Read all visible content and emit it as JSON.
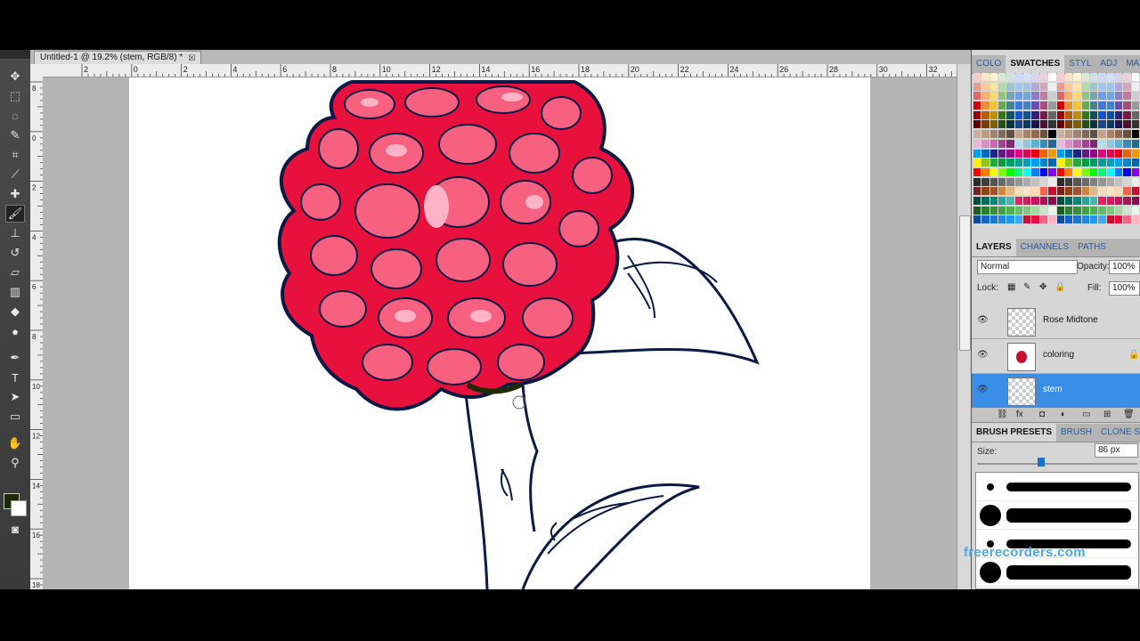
{
  "document": {
    "tab_title": "Untitled-1 @ 19.2% (stem, RGB/8) *",
    "close_glyph": "☒"
  },
  "ruler": {
    "top_labels": [
      "2",
      "0",
      "2",
      "4",
      "6",
      "8",
      "10",
      "12",
      "14",
      "16",
      "18",
      "20",
      "22",
      "24",
      "26",
      "28",
      "30",
      "32"
    ],
    "left_labels": [
      "8",
      "0",
      "2",
      "4",
      "6",
      "8",
      "10",
      "12",
      "14",
      "16",
      "18"
    ]
  },
  "panels": {
    "swatch_tabs": [
      "COLO",
      "SWATCHES",
      "STYL",
      "ADJ",
      "MAS"
    ],
    "layer_tabs": [
      "LAYERS",
      "CHANNELS",
      "PATHS"
    ],
    "blend_mode": "Normal",
    "opacity_label": "Opacity:",
    "opacity_value": "100%",
    "lock_label": "Lock:",
    "fill_label": "Fill:",
    "fill_value": "100%",
    "layers": [
      {
        "name": "Rose Midtone",
        "selected": false
      },
      {
        "name": "coloring",
        "selected": false
      },
      {
        "name": "stem",
        "selected": true
      }
    ],
    "brush_tabs": [
      "BRUSH PRESETS",
      "BRUSH",
      "CLONE SO"
    ],
    "size_label": "Size:",
    "size_value": "86 px"
  },
  "colors": {
    "foreground": "#1e2b05",
    "background": "#ffffff",
    "rose_red": "#e8103c",
    "rose_pink": "#f7617f",
    "outline": "#0b1a45",
    "selection": "#3a8ee6"
  },
  "watermark": "freerecorders.com"
}
